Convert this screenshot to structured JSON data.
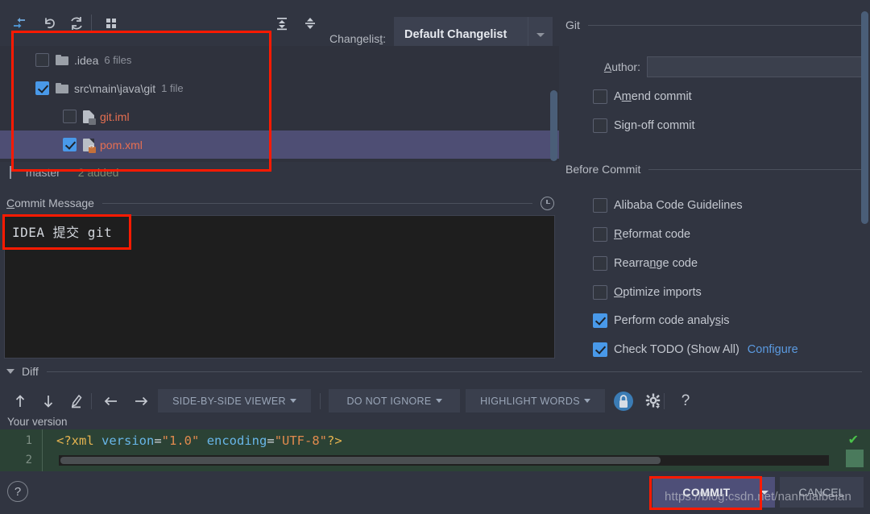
{
  "toolbar": {
    "icons": [
      {
        "name": "rollback-icon",
        "title": "Revert"
      },
      {
        "name": "undo-icon",
        "title": "Undo"
      },
      {
        "name": "refresh-icon",
        "title": "Refresh"
      },
      {
        "name": "group-by-icon",
        "title": "Group By"
      },
      {
        "name": "expand-all-icon",
        "title": "Expand All"
      },
      {
        "name": "collapse-all-icon",
        "title": "Collapse All"
      }
    ],
    "changelist_label": "Changelist:",
    "changelist_mnemonic": "t",
    "changelist_value": "Default Changelist"
  },
  "file_tree": {
    "rows": [
      {
        "kind": "folder",
        "expandable": true,
        "checked": false,
        "selected": false,
        "label": ".idea",
        "count": "6 files",
        "label_style": "dir",
        "icon": "folder-icon"
      },
      {
        "kind": "folder",
        "expandable": true,
        "checked": true,
        "selected": false,
        "label": "src\\main\\java\\git",
        "count": "1 file",
        "label_style": "dir",
        "icon": "folder-icon"
      },
      {
        "kind": "file",
        "expandable": false,
        "checked": false,
        "selected": false,
        "label": "git.iml",
        "count": "",
        "label_style": "added",
        "icon": "iml-file-icon"
      },
      {
        "kind": "file",
        "expandable": false,
        "checked": true,
        "selected": true,
        "label": "pom.xml",
        "count": "",
        "label_style": "added",
        "icon": "xml-file-icon"
      }
    ]
  },
  "status": {
    "branch_icon": "branch-icon",
    "branch": "master",
    "added": "2 added"
  },
  "commit_message": {
    "title": "Commit Message",
    "mnemonic": "C",
    "value": "IDEA 提交 git",
    "history_icon": "history-clock-icon"
  },
  "git_group": {
    "title": "Git",
    "author_label": "Author:",
    "author_mnemonic": "A",
    "author_value": "",
    "options": [
      {
        "label": "Amend commit",
        "mnemonic": "m",
        "checked": false,
        "name": "amend-commit"
      },
      {
        "label": "Sign-off commit",
        "mnemonic": "g",
        "checked": false,
        "name": "sign-off-commit"
      }
    ]
  },
  "before_commit_group": {
    "title": "Before Commit",
    "options": [
      {
        "label": "Alibaba Code Guidelines",
        "mnemonic": "",
        "checked": false,
        "name": "alibaba-code-guidelines"
      },
      {
        "label": "Reformat code",
        "mnemonic": "R",
        "checked": false,
        "name": "reformat-code"
      },
      {
        "label": "Rearrange code",
        "mnemonic": "n",
        "checked": false,
        "name": "rearrange-code"
      },
      {
        "label": "Optimize imports",
        "mnemonic": "O",
        "checked": false,
        "name": "optimize-imports"
      },
      {
        "label": "Perform code analysis",
        "mnemonic": "s",
        "checked": true,
        "name": "perform-code-analysis"
      },
      {
        "label": "Check TODO (Show All)",
        "mnemonic": "",
        "checked": true,
        "name": "check-todo",
        "link": "Configure"
      }
    ]
  },
  "diff": {
    "title": "Diff",
    "toolbar_icons": [
      {
        "name": "previous-difference-icon"
      },
      {
        "name": "next-difference-icon"
      },
      {
        "name": "edit-source-icon"
      },
      {
        "name": "accept-left-icon"
      },
      {
        "name": "accept-right-icon"
      }
    ],
    "viewer_mode": "SIDE-BY-SIDE VIEWER",
    "ignore_mode": "DO NOT IGNORE",
    "highlight_mode": "HIGHLIGHT WORDS",
    "lock_icon": "lock-icon",
    "settings_icon": "gear-icon",
    "help_icon": "question-mark-icon",
    "your_version_label": "Your version"
  },
  "editor": {
    "line_number": "1",
    "line_number_2": "2",
    "code": {
      "open": "<?xml ",
      "attr1": "version",
      "eq1": "=",
      "val1": "\"1.0\"",
      "space": " ",
      "attr2": "encoding",
      "eq2": "=",
      "val2": "\"UTF-8\"",
      "close": "?>"
    },
    "status_ok": "✔"
  },
  "bottom": {
    "help_label": "?",
    "commit_label": "COMMIT",
    "cancel_label": "CANCEL"
  },
  "watermark": {
    "text": "https://blog.csdn.net/nanhuaibeian"
  },
  "colors": {
    "background": "#313541",
    "panel": "#2f323d",
    "selection": "#4e4e74",
    "accent_checkbox": "#4999e9",
    "link": "#5b9ae0",
    "added_file": "#e76f51",
    "commit_button": "#4e4f78",
    "annotation": "#ff1a00",
    "editor_bg": "#2b4235"
  }
}
